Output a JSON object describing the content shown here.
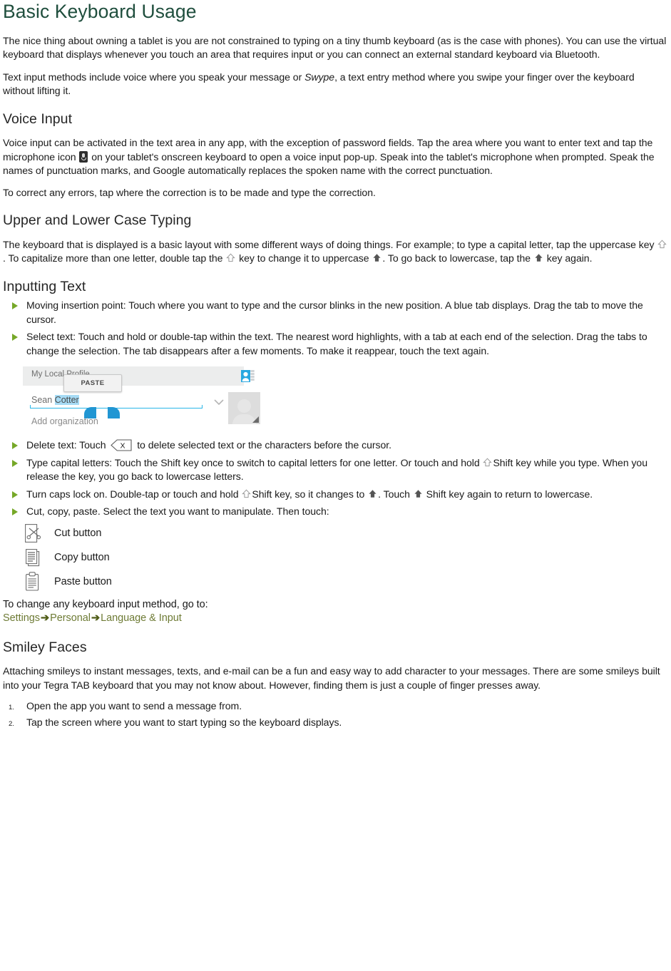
{
  "document": {
    "title": "Basic Keyboard Usage",
    "intro_paragraphs": [
      "The nice thing about owning a tablet is you are not constrained to typing on a tiny thumb keyboard (as is the case with phones). You can use the virtual keyboard that displays whenever you touch an area that requires input or you can connect an external standard keyboard via Bluetooth.",
      "Text input methods include voice where you speak your message or "
    ],
    "intro_p2_italic": "Swype",
    "intro_p2_tail": ", a text entry method where you swipe your finger over the keyboard without lifting it."
  },
  "voice_input": {
    "heading": "Voice Input",
    "para1_before_icon": "Voice input can be activated in the text area in any app, with the exception of password fields. Tap the area where you want to enter text and tap the microphone icon ",
    "para1_after_icon": " on your tablet's onscreen keyboard to open a voice input pop-up. Speak into the tablet's microphone when prompted. Speak the names of punctuation marks, and Google automatically replaces the spoken name with the correct punctuation.",
    "para2": "To correct any errors, tap where the correction is to be made and type the correction."
  },
  "upper_lower": {
    "heading": "Upper and Lower Case Typing",
    "seg1": "The keyboard that is displayed is a basic layout with some different ways of doing things. For example; to type a capital letter, tap the uppercase key ",
    "seg2": ". To capitalize more than one letter, double tap the ",
    "seg3": " key to change it to uppercase ",
    "seg4": ". To go back to lowercase, tap the ",
    "seg5": " key again."
  },
  "inputting_text": {
    "heading": "Inputting Text",
    "bullets": [
      "Moving insertion point: Touch where you want to type and the cursor blinks in the new position. A blue tab displays. Drag the tab to move the cursor.",
      "Select text: Touch and hold or double-tap within the text. The nearest word highlights, with a tab at each end of the selection. Drag the tabs to change the selection. The tab disappears after a few moments. To make it reappear, touch the text again."
    ],
    "delete_before": "Delete text: Touch ",
    "delete_after": " to delete selected text or the characters before the cursor.",
    "capital_before": "Type capital letters: Touch the Shift key once to switch to capital letters for one letter. Or touch and hold ",
    "capital_after": "Shift key while you type. When you release the key, you go back to lowercase letters.",
    "caps_before": "Turn caps lock on. Double-tap or touch and hold ",
    "caps_mid1": "Shift key, so it changes to ",
    "caps_mid2": ". Touch ",
    "caps_after": " Shift key again to return to lowercase.",
    "cutcopy": "Cut, copy, paste. Select the text you want to manipulate. Then touch:",
    "buttons": [
      {
        "icon": "cut-icon",
        "label": "Cut button"
      },
      {
        "icon": "copy-icon",
        "label": "Copy button"
      },
      {
        "icon": "paste-icon",
        "label": "Paste button"
      }
    ],
    "change_method": "To change any keyboard input method, go to:",
    "nav_path": [
      "Settings",
      "Personal",
      "Language & Input"
    ],
    "nav_arrow": "➔"
  },
  "screenshot": {
    "topbar_title": "My Local Profile",
    "paste_label": "PASTE",
    "name_first": "Sean ",
    "name_selected": "Cotter",
    "add_organization": "Add organization"
  },
  "smiley": {
    "heading": "Smiley Faces",
    "para": "Attaching smileys to instant messages, texts, and e-mail can be a fun and easy way to add character to your messages. There are some smileys built into your Tegra TAB keyboard that you may not know about. However, finding them is just a couple of finger presses away.",
    "steps": [
      "Open the app you want to send a message from.",
      "Tap the screen where you want to start typing so the keyboard displays."
    ]
  },
  "colors": {
    "title_green": "#1F4E3D",
    "bullet_green": "#76A828",
    "nav_olive": "#6E7B35",
    "selection_blue": "#A6DBF5",
    "handle_blue": "#2196D3",
    "body_text": "#1A1A1A"
  }
}
